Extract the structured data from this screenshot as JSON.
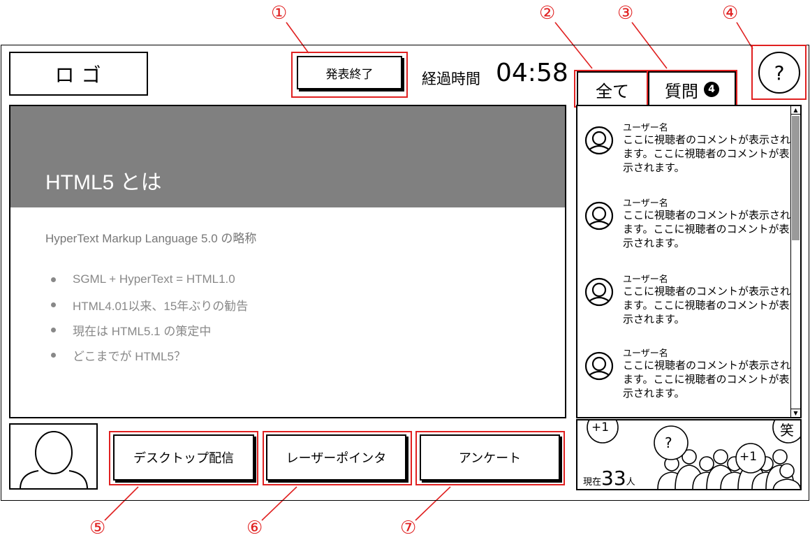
{
  "header": {
    "logo": "ロゴ",
    "end_button": "発表終了",
    "elapsed_label": "経過時間",
    "elapsed_time": "04:58",
    "help": "?"
  },
  "tabs": [
    {
      "label": "全て"
    },
    {
      "label": "質問",
      "badge": "4"
    }
  ],
  "slide": {
    "title": "HTML5 とは",
    "subtitle": "HyperText Markup Language 5.0 の略称",
    "bullets": [
      "SGML + HyperText = HTML1.0",
      "HTML4.01以来、15年ぶりの勧告",
      "現在は HTML5.1 の策定中",
      "どこまでが HTML5？"
    ]
  },
  "comments": [
    {
      "user": "ユーザー名",
      "text": "ここに視聴者のコメントが表示されます。ここに視聴者のコメントが表示されます。"
    },
    {
      "user": "ユーザー名",
      "text": "ここに視聴者のコメントが表示されます。ここに視聴者のコメントが表示されます。"
    },
    {
      "user": "ユーザー名",
      "text": "ここに視聴者のコメントが表示されます。ここに視聴者のコメントが表示されます。"
    },
    {
      "user": "ユーザー名",
      "text": "ここに視聴者のコメントが表示されます。ここに視聴者のコメントが表示されます。"
    }
  ],
  "toolbar": {
    "desktop": "デスクトップ配信",
    "laser": "レーザーポインタ",
    "survey": "アンケート"
  },
  "audience": {
    "current_label": "現在",
    "count": "33",
    "unit": "人",
    "reactions": [
      "+1",
      "?",
      "+1",
      "笑"
    ]
  },
  "callouts": [
    "①",
    "②",
    "③",
    "④",
    "⑤",
    "⑥",
    "⑦"
  ],
  "colors": {
    "annotation": "#e02020",
    "slide_header": "#808080",
    "scroll_thumb": "#9a9a9a"
  }
}
